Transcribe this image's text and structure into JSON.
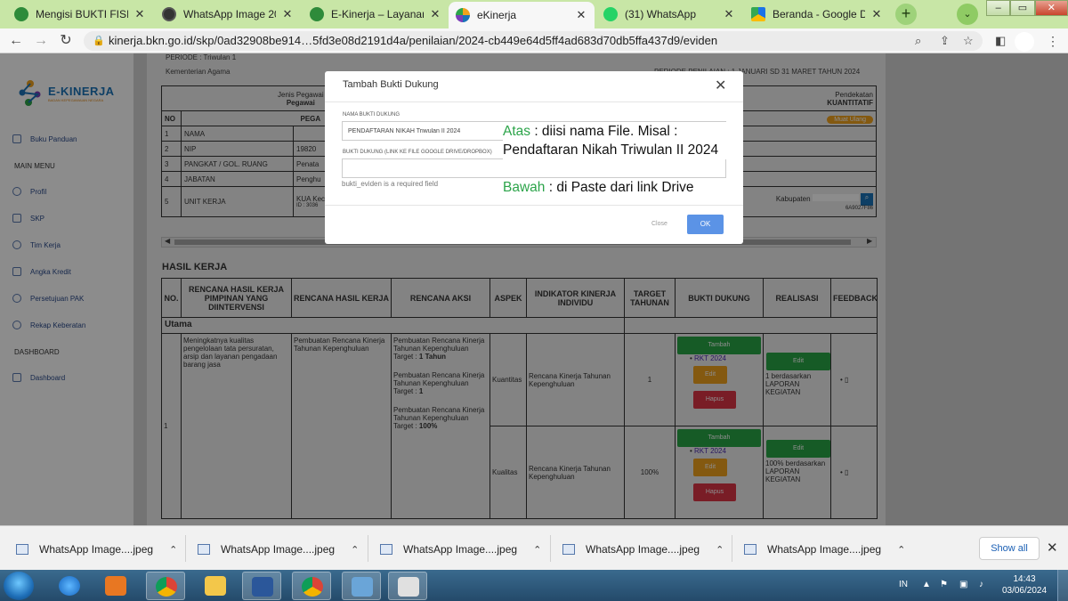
{
  "browser": {
    "tabs": [
      {
        "title": "Mengisi BUKTI FISIK da",
        "icon": "kemenag-icon"
      },
      {
        "title": "WhatsApp Image 2024",
        "icon": "globe-icon"
      },
      {
        "title": "E-Kinerja – Layanan KU",
        "icon": "kemenag-icon"
      },
      {
        "title": "eKinerja",
        "icon": "ekinerja-icon",
        "active": true
      },
      {
        "title": "(31) WhatsApp",
        "icon": "whatsapp-icon"
      },
      {
        "title": "Beranda - Google Drive",
        "icon": "google-drive-icon"
      }
    ],
    "url": "kinerja.bkn.go.id/skp/0ad32908be914…5fd3e08d2191d4a/penilaian/2024-cb449e64d5ff4ad683d70db5ffa437d9/eviden"
  },
  "sidebar": {
    "logo_name": "E-KINERJA",
    "logo_sub": "BADAN KEPEGAWAIAN NEGARA",
    "items": [
      {
        "label": "Buku Panduan"
      },
      {
        "label": "Profil"
      },
      {
        "label": "SKP"
      },
      {
        "label": "Tim Kerja"
      },
      {
        "label": "Angka Kredit"
      },
      {
        "label": "Persetujuan PAK"
      },
      {
        "label": "Rekap Keberatan"
      },
      {
        "label": "Dashboard"
      }
    ],
    "heading_main": "MAIN MENU",
    "heading_dashboard": "DASHBOARD"
  },
  "page": {
    "periode": "PERIODE : Triwulan 1",
    "instansi": "Kementerian Agama",
    "periode_right": "PERIODE PENILAIAN : 1 JANUARI SD 31 MARET TAHUN 2024",
    "jenis_pegawai_label": "Jenis Pegawai",
    "jenis_pegawai_value": "Pegawai",
    "pendekatan_label": "Pendekatan",
    "pendekatan_value": "KUANTITATIF",
    "muat_ulang": "Muat Ulang",
    "no_header": "NO",
    "pegawai_header": "PEGA",
    "info_rows": [
      {
        "no": "1",
        "label": "NAMA",
        "value": ""
      },
      {
        "no": "2",
        "label": "NIP",
        "value": "19820"
      },
      {
        "no": "3",
        "label": "PANGKAT / GOL. RUANG",
        "value": "Penata"
      },
      {
        "no": "4",
        "label": "JABATAN",
        "value": "Penghu"
      },
      {
        "no": "5",
        "label": "UNIT KERJA",
        "value": "KUA Kec",
        "value2": "ID : 3036"
      }
    ],
    "unit_kerja_right": "Kabupaten",
    "unit_kerja_right2": "6A9027F86",
    "section_title": "HASIL KERJA",
    "table_headers": [
      "NO.",
      "RENCANA HASIL KERJA PIMPINAN YANG DIINTERVENSI",
      "RENCANA HASIL KERJA",
      "RENCANA AKSI",
      "ASPEK",
      "INDIKATOR KINERJA INDIVIDU",
      "TARGET TAHUNAN",
      "BUKTI DUKUNG",
      "REALISASI",
      "FEEDBACK"
    ],
    "utama_label": "Utama",
    "row_no": "1",
    "rhk_pimpinan": "Meningkatnya kualitas pengelolaan tata persuratan, arsip dan layanan pengadaan barang jasa",
    "rhk": "Pembuatan Rencana Kinerja Tahunan Kepenghuluan",
    "aksi": [
      {
        "text": "Pembuatan Rencana Kinerja Tahunan Kepenghuluan",
        "target_label": "Target :",
        "target": "1 Tahun"
      },
      {
        "text": "Pembuatan Rencana Kinerja Tahunan Kepenghuluan",
        "target_label": "Target :",
        "target": "1"
      },
      {
        "text": "Pembuatan Rencana Kinerja Tahunan Kepenghuluan",
        "target_label": "Target :",
        "target": "100%"
      }
    ],
    "sub_rows": [
      {
        "aspek": "Kuantitas",
        "indikator": "Rencana Kinerja Tahunan Kepenghuluan",
        "target": "1",
        "tambah": "Tambah",
        "link": "RKT 2024",
        "edit": "Edit",
        "hapus": "Hapus",
        "realisasi_edit": "Edit",
        "realisasi": "1 berdasarkan LAPORAN KEGIATAN"
      },
      {
        "aspek": "Kualitas",
        "indikator": "Rencana Kinerja Tahunan Kepenghuluan",
        "target": "100%",
        "tambah": "Tambah",
        "link": "RKT 2024",
        "edit": "Edit",
        "hapus": "Hapus",
        "realisasi_edit": "Edit",
        "realisasi": "100% berdasarkan LAPORAN KEGIATAN"
      }
    ],
    "feedback_bullet": "▯"
  },
  "modal": {
    "title": "Tambah Bukti Dukung",
    "label_nama": "NAMA BUKTI DUKUNG",
    "value_nama": "PENDAFTARAN NIKAH Triwulan II 2024",
    "label_link": "BUKTI DUKUNG (LINK KE FILE GOOGLE DRIVE/DROPBOX)",
    "value_link": "",
    "error": "bukti_eviden is a required field",
    "close_label": "Close",
    "ok_label": "OK"
  },
  "annotation": {
    "atas_word": "Atas",
    "atas_text": " : diisi nama File. Misal : Pendaftaran Nikah Triwulan II 2024",
    "bawah_word": "Bawah",
    "bawah_text": " : di Paste dari link Drive"
  },
  "downloads": {
    "items": [
      "WhatsApp Image....jpeg",
      "WhatsApp Image....jpeg",
      "WhatsApp Image....jpeg",
      "WhatsApp Image....jpeg",
      "WhatsApp Image....jpeg"
    ],
    "show_all": "Show all"
  },
  "taskbar": {
    "lang": "IN",
    "time": "14:43",
    "date": "03/06/2024"
  },
  "colors": {
    "tabbar": "#c8e6a6",
    "green_button": "#28a745",
    "orange_button": "#f0a21e",
    "red_button": "#dc3545",
    "ok_button": "#5b93e6",
    "annotation_green": "#2ca44a"
  }
}
